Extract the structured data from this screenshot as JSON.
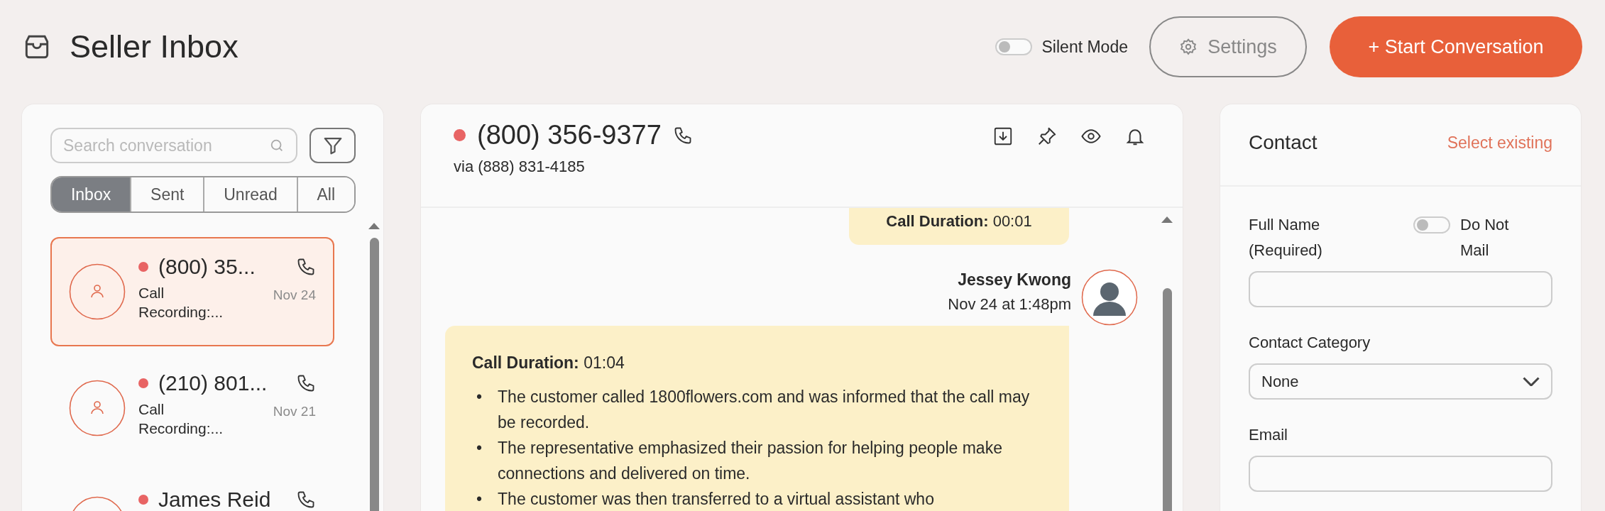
{
  "header": {
    "title": "Seller Inbox",
    "silent_mode": {
      "label": "Silent Mode",
      "on": false
    },
    "settings_button": "Settings",
    "start_button": "+ Start Conversation"
  },
  "conversation_list": {
    "search": {
      "placeholder": "Search conversation"
    },
    "tabs": [
      {
        "label": "Inbox",
        "selected": true
      },
      {
        "label": "Sent",
        "selected": false
      },
      {
        "label": "Unread",
        "selected": false
      },
      {
        "label": "All",
        "selected": false
      }
    ],
    "items": [
      {
        "name": "(800) 35...",
        "preview": "Call Recording:...",
        "date": "Nov 24",
        "selected": true,
        "unread": true
      },
      {
        "name": "(210) 801...",
        "preview": "Call Recording:...",
        "date": "Nov 21",
        "selected": false,
        "unread": true
      },
      {
        "name": "James Reid",
        "selected": false,
        "unread": true
      }
    ]
  },
  "conversation": {
    "phone": "(800) 356-9377",
    "via": "via (888) 831-4185",
    "unread": true,
    "messages": [
      {
        "kind": "note",
        "text": "**Call Duration:** 00:01"
      },
      {
        "kind": "summary",
        "author": "Jessey Kwong",
        "time": "Nov 24 at 1:48pm",
        "text": "**Call Duration:** 01:04",
        "marker": "•",
        "bullets": [
          "The customer called 1800flowers.com and was informed that the call may be recorded.",
          "The representative emphasized their passion for helping people make connections and delivered on time.",
          "The customer was then transferred to a virtual assistant who"
        ]
      }
    ]
  },
  "contact": {
    "title": "Contact",
    "select_existing": "Select existing",
    "do_not_mail": {
      "label": "Do Not Mail",
      "on": false
    },
    "fields": [
      {
        "kind": "text",
        "label": "Full Name (Required)"
      },
      {
        "kind": "select",
        "label": "Contact Category",
        "value": "None"
      },
      {
        "kind": "text",
        "label": "Email"
      }
    ]
  }
}
